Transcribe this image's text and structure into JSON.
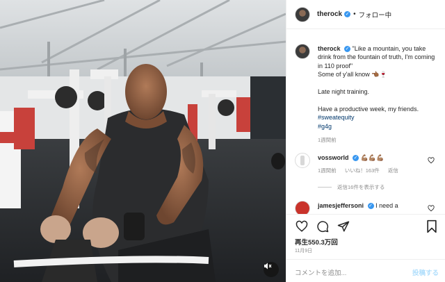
{
  "post_author": {
    "username": "therock",
    "follow_status": "フォロー中"
  },
  "caption": {
    "username": "therock",
    "lines": [
      "\"Like a mountain, you take drink from the fountain of truth, I'm coming in 110 proof\"",
      "Some of y'all know 👈🏾🍷",
      "Late night training.",
      "Have a productive week, my friends."
    ],
    "hashtags": [
      "#sweatequity",
      "#g4g"
    ],
    "time": "1週間前"
  },
  "comments": [
    {
      "username": "vossworld",
      "text": "💪🏽💪🏽💪🏽",
      "time": "1週間前",
      "likes": "いいね！163件",
      "reply": "返信",
      "view_replies": "返信16件を表示する"
    },
    {
      "username": "jamesjeffersoni",
      "text": "I need a"
    }
  ],
  "actions": {
    "views": "再生550.3万回",
    "date": "11月9日",
    "comment_placeholder": "コメントを追加...",
    "post_label": "投稿する"
  },
  "icons": {
    "like": "heart-icon",
    "comment": "comment-icon",
    "share": "paper-plane-icon",
    "save": "bookmark-icon",
    "mute": "speaker-muted-icon"
  },
  "colors": {
    "verified": "#3897f0",
    "hashtag": "#00376b",
    "muted_text": "#8e8e8e",
    "post_button": "#b2dffc"
  }
}
